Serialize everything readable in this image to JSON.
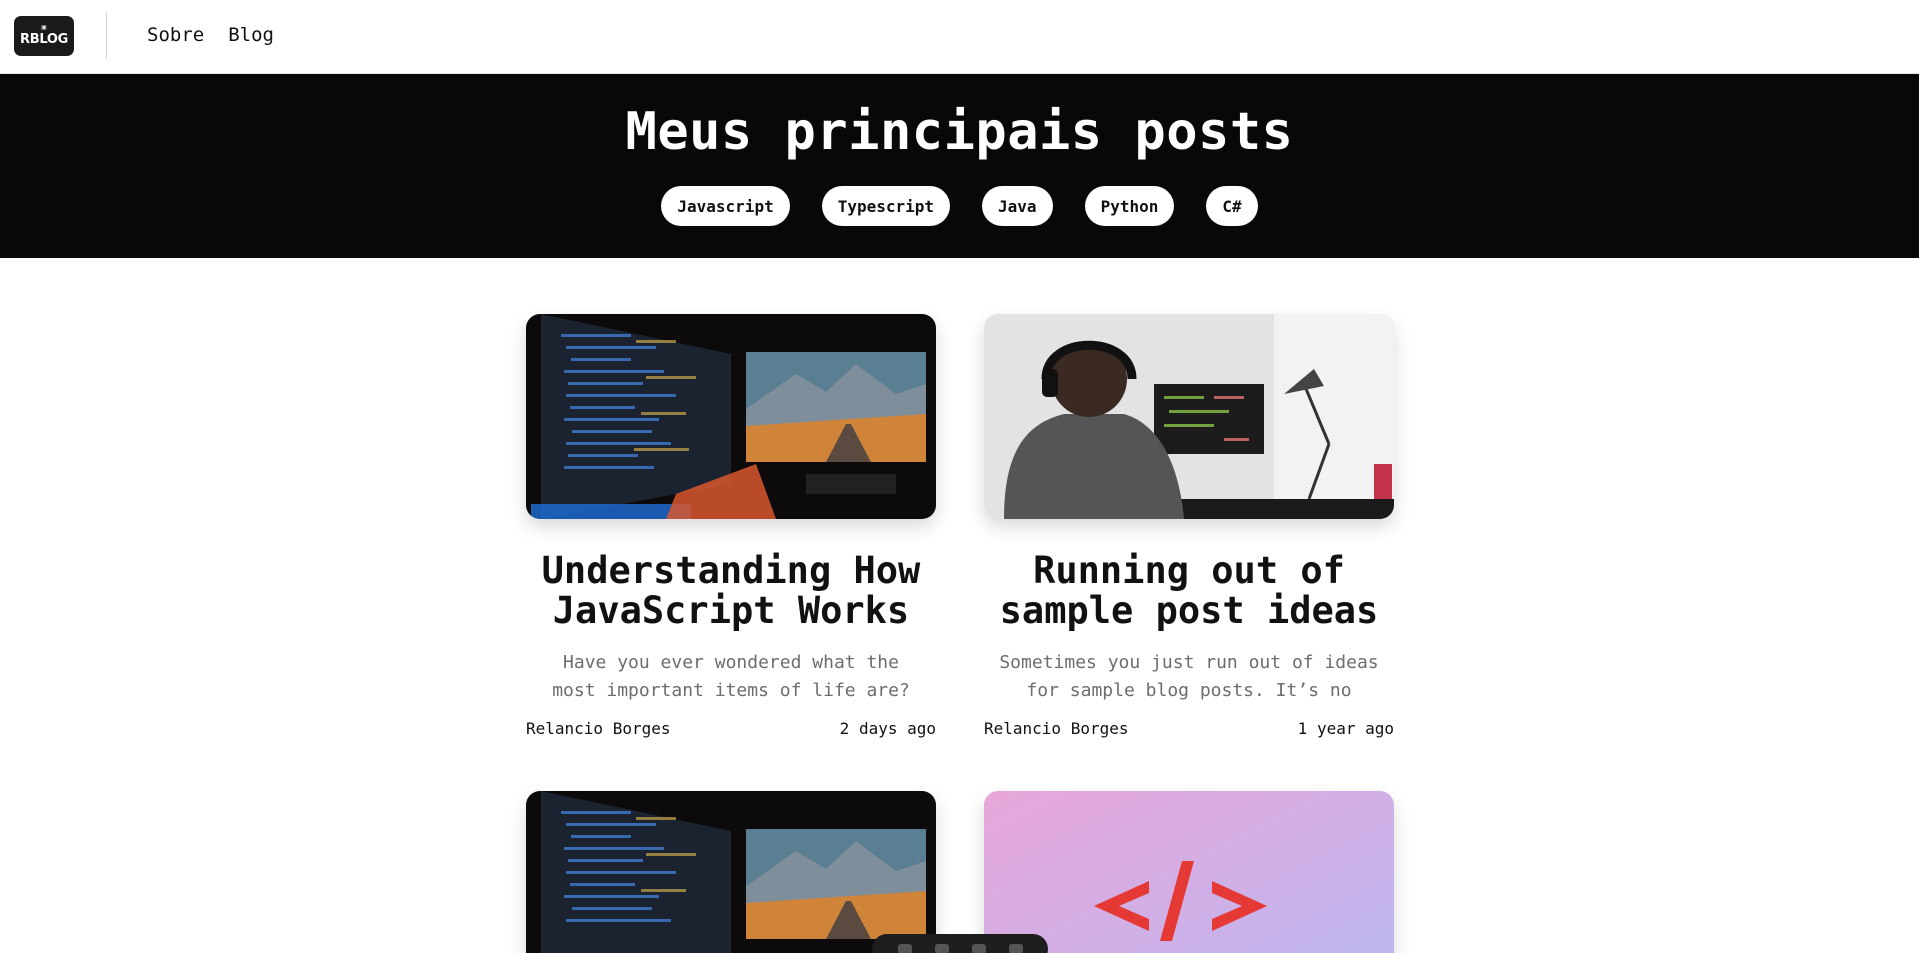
{
  "header": {
    "logo_text": "RBLOG",
    "nav": [
      {
        "label": "Sobre"
      },
      {
        "label": "Blog"
      }
    ]
  },
  "hero": {
    "title": "Meus principais posts",
    "tags": [
      "Javascript",
      "Typescript",
      "Java",
      "Python",
      "C#"
    ]
  },
  "posts": [
    {
      "title": "Understanding How JavaScript Works",
      "excerpt": "Have you ever wondered what the most important items of life are? Well,…",
      "author": "Relancio Borges",
      "date": "2 days ago",
      "image": "monitors-landscape"
    },
    {
      "title": "Running out of sample post ideas",
      "excerpt": "Sometimes you just run out of ideas for sample blog posts. It’s no one’…",
      "author": "Relancio Borges",
      "date": "1 year ago",
      "image": "man-headphones-desk"
    },
    {
      "title": "",
      "excerpt": "",
      "author": "",
      "date": "",
      "image": "monitors-landscape"
    },
    {
      "title": "",
      "excerpt": "",
      "author": "",
      "date": "",
      "image": "code-tag-symbol"
    }
  ],
  "colors": {
    "hero_bg": "#080808",
    "accent_red": "#e53935",
    "text": "#111111",
    "muted": "#6d6d6d"
  }
}
